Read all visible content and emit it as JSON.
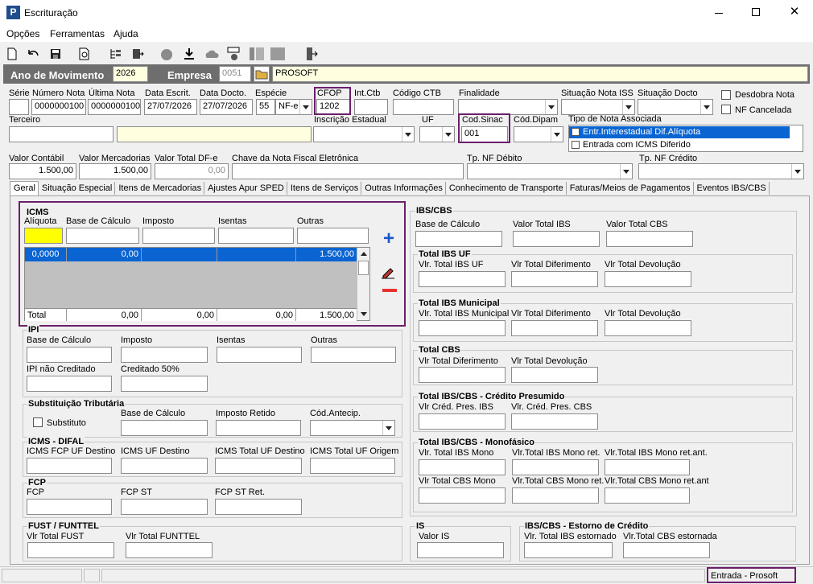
{
  "window": {
    "title": "Escrituração"
  },
  "menu": [
    "Opções",
    "Ferramentas",
    "Ajuda"
  ],
  "toolbar_icons": [
    "new-document-icon",
    "undo-icon",
    "save-icon",
    "preview-icon",
    "tree-icon",
    "export-icon",
    "apple-icon",
    "download-icon",
    "cloud-icon",
    "cib-icon",
    "columns-icon",
    "square-icon",
    "exit-icon"
  ],
  "header": {
    "ano_label": "Ano de Movimento",
    "ano_value": "2026",
    "empresa_label": "Empresa",
    "empresa_code": "0051",
    "empresa_name": "PROSOFT"
  },
  "fields": {
    "serie": {
      "label": "Série",
      "value": ""
    },
    "numero_nota": {
      "label": "Número Nota",
      "value": "0000000100"
    },
    "ultima_nota": {
      "label": "Última Nota",
      "value": "0000000100"
    },
    "data_escrit": {
      "label": "Data Escrit.",
      "value": "27/07/2026"
    },
    "data_docto": {
      "label": "Data Docto.",
      "value": "27/07/2026"
    },
    "especie": {
      "label": "Espécie",
      "code": "55",
      "value": "NF-e"
    },
    "cfop": {
      "label": "CFOP",
      "value": "1202"
    },
    "int_ctb": {
      "label": "Int.Ctb",
      "value": ""
    },
    "codigo_ctb": {
      "label": "Código CTB",
      "value": ""
    },
    "finalidade": {
      "label": "Finalidade",
      "value": ""
    },
    "situacao_iss": {
      "label": "Situação Nota ISS",
      "value": ""
    },
    "situacao_docto": {
      "label": "Situação Docto",
      "value": ""
    },
    "desdobra": {
      "label": "Desdobra Nota"
    },
    "nf_cancelada": {
      "label": "NF Cancelada"
    },
    "terceiro": {
      "label": "Terceiro",
      "value": ""
    },
    "inscricao": {
      "label": "Inscrição Estadual",
      "value": ""
    },
    "uf": {
      "label": "UF",
      "value": ""
    },
    "cod_sinac": {
      "label": "Cod.Sinac",
      "value": "001"
    },
    "cod_dipam": {
      "label": "Cód.Dipam",
      "value": ""
    },
    "tipo_nota": {
      "label": "Tipo de Nota Associada",
      "options": [
        "Entr.Interestadual Dif.Alíquota",
        "Entrada com ICMS Diferido"
      ]
    },
    "valor_contabil": {
      "label": "Valor Contábil",
      "value": "1.500,00"
    },
    "valor_mercadorias": {
      "label": "Valor Mercadorias",
      "value": "1.500,00"
    },
    "valor_total_dfe": {
      "label": "Valor Total DF-e",
      "value": "0,00"
    },
    "chave_nf": {
      "label": "Chave da Nota Fiscal Eletrônica",
      "value": ""
    },
    "tp_nf_debito": {
      "label": "Tp. NF Débito",
      "value": ""
    },
    "tp_nf_credito": {
      "label": "Tp. NF Crédito",
      "value": ""
    }
  },
  "tabs": [
    "Geral",
    "Situação Especial",
    "Itens de Mercadorias",
    "Ajustes Apur SPED",
    "Itens de Serviços",
    "Outras Informações",
    "Conhecimento de Transporte",
    "Faturas/Meios de Pagamentos",
    "Eventos IBS/CBS"
  ],
  "icms": {
    "title": "ICMS",
    "labels": [
      "Alíquota",
      "Base de Cálculo",
      "Imposto",
      "Isentas",
      "Outras"
    ],
    "row": [
      "0,0000",
      "0,00",
      "",
      "",
      "1.500,00"
    ],
    "total_label": "Total",
    "totals": [
      "0,00",
      "0,00",
      "0,00",
      "1.500,00"
    ]
  },
  "ipi": {
    "title": "IPI",
    "labels": [
      "Base de Cálculo",
      "Imposto",
      "Isentas",
      "Outras",
      "IPI não Creditado",
      "Creditado 50%"
    ]
  },
  "st": {
    "title": "Substituição Tributária",
    "substituto": "Substituto",
    "labels": [
      "Base de Cálculo",
      "Imposto Retido",
      "Cód.Antecip."
    ]
  },
  "difal": {
    "title": "ICMS - DIFAL",
    "labels": [
      "ICMS FCP UF Destino",
      "ICMS UF Destino",
      "ICMS Total UF Destino",
      "ICMS Total UF Origem"
    ]
  },
  "fcp": {
    "title": "FCP",
    "labels": [
      "FCP",
      "FCP ST",
      "FCP ST Ret."
    ]
  },
  "fust": {
    "title": "FUST / FUNTTEL",
    "labels": [
      "Vlr Total FUST",
      "Vlr Total FUNTTEL"
    ]
  },
  "ibscbs": {
    "title": "IBS/CBS",
    "labels": [
      "Base de Cálculo",
      "Valor Total IBS",
      "Valor Total CBS"
    ]
  },
  "ibs_uf": {
    "title": "Total IBS UF",
    "labels": [
      "Vlr. Total IBS UF",
      "Vlr Total Diferimento",
      "Vlr Total Devolução"
    ]
  },
  "ibs_mun": {
    "title": "Total IBS Municipal",
    "labels": [
      "Vlr. Total IBS Municipal",
      "Vlr Total Diferimento",
      "Vlr Total Devolução"
    ]
  },
  "cbs": {
    "title": "Total CBS",
    "labels": [
      "Vlr Total Diferimento",
      "Vlr Total Devolução"
    ]
  },
  "cred_pres": {
    "title": "Total IBS/CBS - Crédito Presumido",
    "labels": [
      "Vlr Créd. Pres. IBS",
      "Vlr. Créd. Pres. CBS"
    ]
  },
  "mono": {
    "title": "Total IBS/CBS - Monofásico",
    "labels": [
      "Vlr. Total IBS Mono",
      "Vlr.Total IBS Mono ret.",
      "Vlr.Total IBS Mono ret.ant.",
      "Vlr Total CBS Mono",
      "Vlr.Total CBS Mono ret.",
      "Vlr.Total CBS Mono ret.ant"
    ]
  },
  "is": {
    "title": "IS",
    "labels": [
      "Valor IS"
    ]
  },
  "estorno": {
    "title": "IBS/CBS - Estorno de Crédito",
    "labels": [
      "Vlr. Total IBS estornado",
      "Vlr.Total CBS estornada"
    ]
  },
  "status": {
    "text": "Entrada - Prosoft"
  },
  "colors": {
    "accent": "#6b1f6b",
    "selection": "#0a64d2",
    "highlight_yellow": "#ffff00"
  }
}
